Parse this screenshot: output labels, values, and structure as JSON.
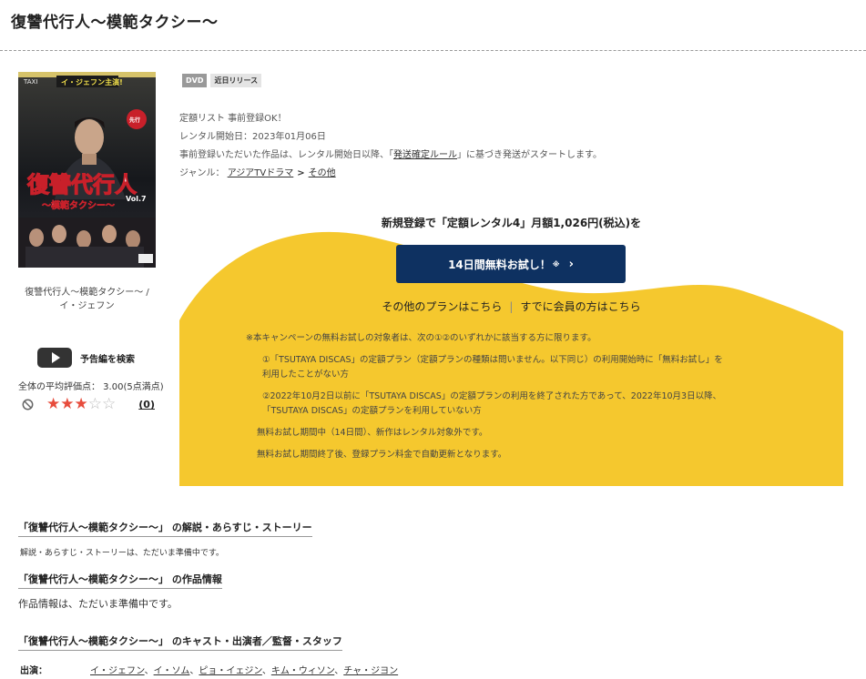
{
  "page": {
    "title": "復讐代行人～模範タクシー～"
  },
  "cover": {
    "caption_line1": "復讐代行人～模範タクシー～ /",
    "caption_line2": "イ・ジェフン",
    "art_top_tag": "イ・ジェフン主演!",
    "art_title": "復讐代行人",
    "art_subtitle": "～模範タクシー～",
    "art_vol": "Vol.7",
    "art_taxi": "TAXI"
  },
  "trailer": {
    "label": "予告編を検索"
  },
  "rating": {
    "summary": "全体の平均評価点： 3.00(5点満点)",
    "stars_filled": 3,
    "stars_total": 5,
    "review_count": "(0)"
  },
  "badges": [
    "DVD",
    "近日リリース"
  ],
  "info": {
    "line1": "定額リスト 事前登録OK！",
    "line2": "レンタル開始日：2023年01月06日",
    "line3_pre": "事前登録いただいた作品は、レンタル開始日以降、「",
    "line3_link": "発送確定ルール",
    "line3_post": "」に基づき発送がスタートします。",
    "genre_label": "ジャンル：",
    "genre_link1": "アジアTVドラマ",
    "genre_sep": ">",
    "genre_link2": "その他"
  },
  "campaign": {
    "headline": "新規登録で「定額レンタル4」月額1,026円(税込)を",
    "button_label": "14日間無料お試し！",
    "button_note": "※",
    "button_chevron": "›",
    "link_other_plans": "その他のプランはこちら",
    "link_separator": "|",
    "link_member": "すでに会員の方はこちら",
    "notes": {
      "n1": "※本キャンペーンの無料お試しの対象者は、次の①②のいずれかに該当する方に限ります。",
      "n2a": "①「TSUTAYA DISCAS」の定額プラン（定額プランの種類は問いません。以下同じ）の利用開始時に「無料お試し」を",
      "n2b": "利用したことがない方",
      "n3a": "②2022年10月2日以前に「TSUTAYA DISCAS」の定額プランの利用を終了された方であって、2022年10月3日以降、",
      "n3b": "「TSUTAYA DISCAS」の定額プランを利用していない方",
      "n4": "無料お試し期間中（14日間）、新作はレンタル対象外です。",
      "n5": "無料お試し期間終了後、登録プラン料金で自動更新となります。"
    },
    "bg_color": "#f5c82e",
    "button_color": "#0e3161"
  },
  "sections": {
    "story_head": "「復讐代行人～模範タクシー～」 の解説・あらすじ・ストーリー",
    "story_body": "解説・あらすじ・ストーリーは、ただいま準備中です。",
    "info_head": "「復讐代行人～模範タクシー～」 の作品情報",
    "info_body": "作品情報は、ただいま準備中です。",
    "cast_head": "「復讐代行人～模範タクシー～」 のキャスト・出演者／監督・スタッフ",
    "cast_label": "出演：",
    "cast": [
      "イ・ジェフン",
      "イ・ソム",
      "ピョ・イェジン",
      "キム・ウィソン",
      "チャ・ジヨン"
    ],
    "cast_sep": "、"
  }
}
